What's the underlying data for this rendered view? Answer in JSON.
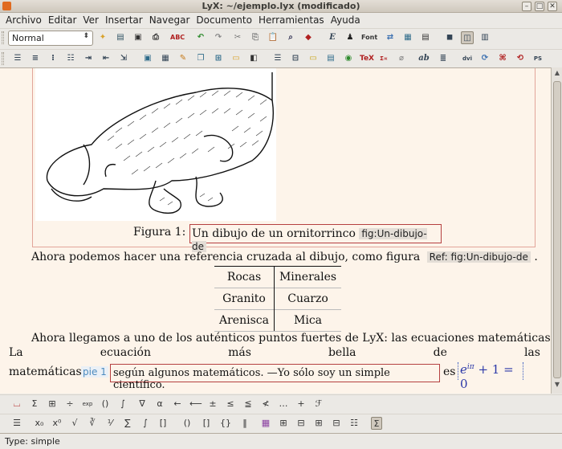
{
  "window": {
    "title": "LyX: ~/ejemplo.lyx (modificado)",
    "minimize": "–",
    "maximize": "□",
    "close": "✕"
  },
  "menu": [
    "Archivo",
    "Editar",
    "Ver",
    "Insertar",
    "Navegar",
    "Documento",
    "Herramientas",
    "Ayuda"
  ],
  "toolbar": {
    "layout_value": "Normal",
    "font_label": "Font"
  },
  "document": {
    "figure_caption_prefix": "Figura 1:",
    "figure_caption_text": "Un dibujo de un ornitorrinco",
    "figure_label": "fig:Un-dibujo-de",
    "paragraph1_text": "Ahora podemos hacer una referencia cruzada al dibujo, como figura",
    "paragraph1_ref": "Ref: fig:Un-dibujo-de",
    "paragraph1_end": ".",
    "table_rows": [
      [
        "Rocas",
        "Minerales"
      ],
      [
        "Granito",
        "Cuarzo"
      ],
      [
        "Arenisca",
        "Mica"
      ]
    ],
    "paragraph2_line1": "Ahora llegamos a uno de los auténticos puntos fuertes de LyX: las ecuaciones matemáticas.",
    "paragraph2_words": [
      "La",
      "ecuación",
      "más",
      "bella",
      "de",
      "las"
    ],
    "paragraph2_line3_start": "matemáticas",
    "footnote_label": "pie 1",
    "footnote_text": "según algunos matemáticos. —Yo sólo soy un simple científico.",
    "paragraph2_es": "es",
    "math_e": "e",
    "math_exp": "iπ",
    "math_rest": "+ 1 = 0"
  },
  "status": {
    "text": "Type: simple"
  }
}
